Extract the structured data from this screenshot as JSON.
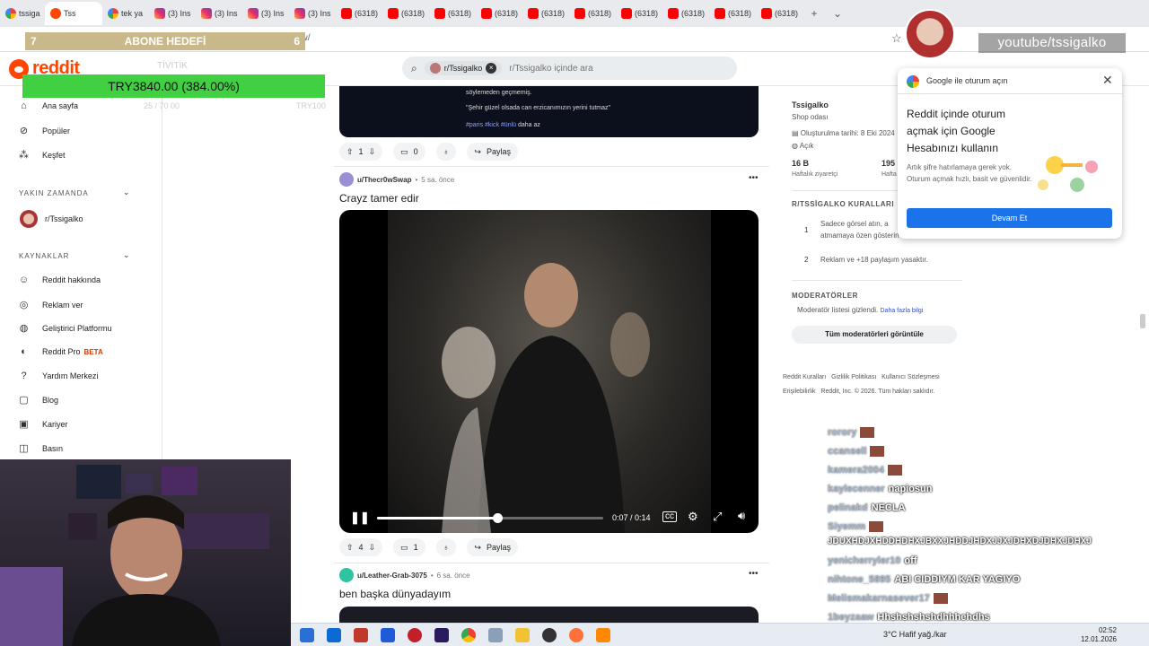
{
  "browser": {
    "tabs": [
      {
        "label": "tssiga",
        "favicon": "google-icon"
      },
      {
        "label": "Tss",
        "favicon": "reddit-icon",
        "active": true
      },
      {
        "label": "tek ya",
        "favicon": "google-icon"
      },
      {
        "label": "(3) Ins",
        "favicon": "instagram-icon"
      },
      {
        "label": "(3) Ins",
        "favicon": "instagram-icon"
      },
      {
        "label": "(3) Ins",
        "favicon": "instagram-icon"
      },
      {
        "label": "(3) Ins",
        "favicon": "instagram-icon"
      },
      {
        "label": "(6318)",
        "favicon": "youtube-icon"
      },
      {
        "label": "(6318)",
        "favicon": "youtube-icon"
      },
      {
        "label": "(6318)",
        "favicon": "youtube-icon"
      },
      {
        "label": "(6318)",
        "favicon": "youtube-icon"
      },
      {
        "label": "(6318)",
        "favicon": "youtube-icon"
      },
      {
        "label": "(6318)",
        "favicon": "youtube-icon"
      },
      {
        "label": "(6318)",
        "favicon": "youtube-icon"
      },
      {
        "label": "(6318)",
        "favicon": "youtube-icon"
      },
      {
        "label": "(6318)",
        "favicon": "youtube-icon"
      },
      {
        "label": "(6318)",
        "favicon": "youtube-icon"
      }
    ],
    "url_fragment": "ew/"
  },
  "overlay": {
    "abone_left": "7",
    "abone_title": "ABONE HEDEFİ",
    "abone_right": "6",
    "try_text": "TRY3840.00 (384.00%)",
    "ghost_top": "TİVİTİK",
    "ghost_left": "25 / 70 00",
    "ghost_right": "TRY100",
    "youtube_handle": "youtube/tssigalko"
  },
  "header": {
    "logo": "reddit",
    "search_chip": "r/Tssigalko",
    "search_placeholder": "r/Tssigalko içinde ara"
  },
  "sidebar": {
    "items": [
      {
        "label": "Ana sayfa",
        "icon": "home-icon"
      },
      {
        "label": "Popüler",
        "icon": "popular-icon"
      },
      {
        "label": "Keşfet",
        "icon": "explore-icon"
      }
    ],
    "recent_heading": "YAKIN ZAMANDA",
    "recent_item": "r/Tssigalko",
    "resources_heading": "KAYNAKLAR",
    "resources": [
      {
        "label": "Reddit hakkında",
        "icon": "reddit-about-icon"
      },
      {
        "label": "Reklam ver",
        "icon": "advertise-icon"
      },
      {
        "label": "Geliştirici Platformu",
        "icon": "developer-icon"
      },
      {
        "label": "Reddit Pro",
        "icon": "pro-icon",
        "badge": "BETA"
      },
      {
        "label": "Yardım Merkezi",
        "icon": "help-icon"
      },
      {
        "label": "Blog",
        "icon": "blog-icon"
      },
      {
        "label": "Kariyer",
        "icon": "career-icon"
      },
      {
        "label": "Basın",
        "icon": "press-icon"
      }
    ]
  },
  "feed": {
    "prev_post": {
      "media_text_1": "söylemeden geçmemiş.",
      "media_text_2": "\"Şehir güzel olsada can erzicanımızın yerini tutmaz\"",
      "media_tags": "#paris #kick #ünlü",
      "media_more": "daha az",
      "votes": "1",
      "comments": "0",
      "share": "Paylaş"
    },
    "post": {
      "author": "u/Thecr0wSwap",
      "time": "5 sa. önce",
      "title": "Crayz tamer edir",
      "video_time": "0:07 / 0:14",
      "progress": 0.5,
      "votes": "4",
      "comments": "1",
      "share": "Paylaş"
    },
    "next_post": {
      "author": "u/Leather-Grab-3075",
      "time": "6 sa. önce",
      "title": "ben başka dünyadayım"
    }
  },
  "community": {
    "name": "Tssigalko",
    "subtitle": "Shop odası",
    "created": "Oluşturulma tarihi: 8 Eki 2024",
    "visibility": "Açık",
    "weekly_visitors_value": "16 B",
    "weekly_visitors_label": "Haftalık ziyaretçi",
    "weekly_contrib_value": "195",
    "weekly_contrib_label": "Hafta",
    "rules_heading": "R/TSSİGALKO KURALLARI",
    "rules": [
      {
        "num": "1",
        "line1": "Sadece görsel atın, a",
        "line2": "atmamaya özen gösterin"
      },
      {
        "num": "2",
        "line1": "Reklam ve +18 paylaşım yasaktır.",
        "line2": ""
      }
    ],
    "mods_heading": "MODERATÖRLER",
    "mods_hidden": "Moderatör listesi gizlendi.",
    "mods_more": "Daha fazla bilgi",
    "mods_button": "Tüm moderatörleri görüntüle",
    "footer_1": "Reddit Kuralları",
    "footer_2": "Gizlilik Politikası",
    "footer_3": "Kullanıcı Sözleşmesi",
    "footer_4": "Erişilebilirlik",
    "footer_5": "Reddit, Inc. © 2026. Tüm hakları saklıdır."
  },
  "google_popup": {
    "header": "Google ile oturum açın",
    "title": "Reddit içinde oturum açmak için Google Hesabınızı kullanın",
    "body": "Artık şifre hatırlamaya gerek yok. Oturum açmak hızlı, basit ve güvenlidir.",
    "button": "Devam Et"
  },
  "chat": [
    {
      "user": "rorory",
      "msg": ""
    },
    {
      "user": "ccansell",
      "msg": ""
    },
    {
      "user": "kamera2004",
      "msg": ""
    },
    {
      "user": "kaylecenner",
      "msg": "napiosun"
    },
    {
      "user": "pelinakd",
      "msg": "NECLA"
    },
    {
      "user": "Siyemm",
      "msg": ""
    },
    {
      "user": "",
      "msg": "JDUXHDJXHDDHDHXJBXXJHDDJHDXJJXJDHXDJDHXJDHXJ"
    },
    {
      "user": "yenicherry​ler10",
      "msg": "off"
    },
    {
      "user": "nihtone_5895",
      "msg": "ABI CIDDIYM KAR YAGIYO"
    },
    {
      "user": "Melismakarnasever17",
      "msg": ""
    },
    {
      "user": "1beyzaaw",
      "msg": "Hhshshshshdhhhehdhs"
    }
  ],
  "taskbar": {
    "weather": "3°C  Hafif yağ./kar",
    "time": "02:52",
    "date": "12.01.2026"
  },
  "colors": {
    "reddit_orange": "#ff4500",
    "green_bar": "#41d042",
    "google_blue": "#1a73e8"
  }
}
